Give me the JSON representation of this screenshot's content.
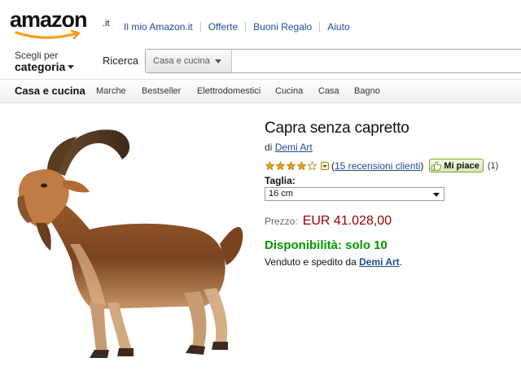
{
  "header": {
    "logo_text": "amazon",
    "logo_tld": ".it",
    "links": [
      "Il mio Amazon.it",
      "Offerte",
      "Buoni Regalo",
      "Aiuto"
    ]
  },
  "search": {
    "shop_by_line1": "Scegli per",
    "shop_by_line2": "categoria",
    "label": "Ricerca",
    "scope": "Casa e cucina"
  },
  "nav": {
    "main": "Casa e cucina",
    "items": [
      "Marche",
      "Bestseller",
      "Elettrodomestici",
      "Cucina",
      "Casa",
      "Bagno"
    ]
  },
  "product": {
    "title": "Capra senza capretto",
    "by_prefix": "di",
    "brand": "Demi Art",
    "rating": 4,
    "rating_max": 5,
    "reviews_open": "(",
    "reviews_link": "15 recensioni clienti",
    "reviews_close": ")",
    "like_label": "Mi piace",
    "like_count": "(1)",
    "size_label": "Taglia:",
    "size_value": "16 cm",
    "price_label": "Prezzo:",
    "price_value": "EUR 41.028,00",
    "availability": "Disponibilità: solo 10",
    "sold_by_prefix": "Venduto e spedito da",
    "sold_by": "Demi Art",
    "sold_by_suffix": "."
  },
  "colors": {
    "link": "#1a4e99",
    "price": "#990000",
    "availability": "#009900",
    "logo_smile": "#f79c1c",
    "star": "#e8a317"
  },
  "icons": {
    "logo_smile": "amazon-smile-arrow-icon",
    "stars": "star-icon",
    "rating_dropdown": "chevron-down-icon",
    "like": "thumbs-up-icon",
    "scope_dropdown": "caret-down-icon"
  }
}
